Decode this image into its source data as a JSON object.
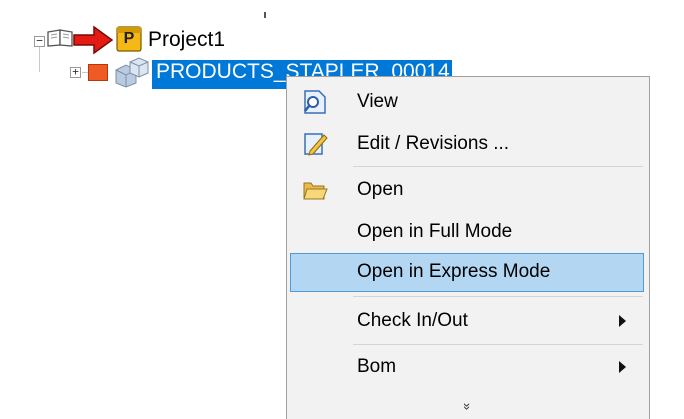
{
  "tree": {
    "project": {
      "label": "Project1",
      "badge": "P"
    },
    "product": {
      "label": "PRODUCTS_STAPLER_00014"
    },
    "expand_glyph": "⊞",
    "collapse_glyph": "⊟"
  },
  "context_menu": {
    "items": [
      {
        "label": "View",
        "icon": "view-icon"
      },
      {
        "label": "Edit / Revisions ...",
        "icon": "edit-icon"
      },
      {
        "label": "Open",
        "icon": "open-folder-icon"
      },
      {
        "label": "Open in Full Mode"
      },
      {
        "label": "Open in Express Mode",
        "highlighted": true
      },
      {
        "label": "Check In/Out",
        "submenu": true
      },
      {
        "label": "Bom",
        "submenu": true
      }
    ],
    "more_glyph": "»"
  },
  "colors": {
    "selection": "#0078d7",
    "menu_bg": "#f2f2f2",
    "highlight_bg": "#b3d7f3",
    "highlight_border": "#4f9ad8",
    "badge_fill": "#f6b817",
    "arrow_red": "#e41b13"
  }
}
